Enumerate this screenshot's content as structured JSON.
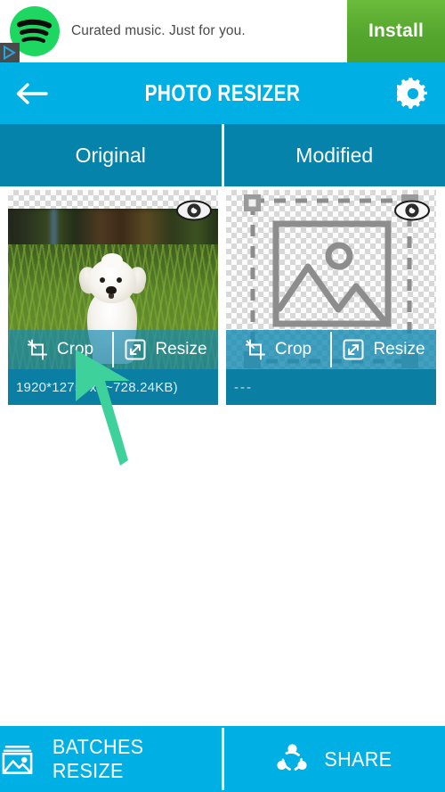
{
  "ad": {
    "advertiser_icon": "spotify-logo",
    "text": "Curated music. Just for you.",
    "install_label": "Install",
    "adchoices_icon": "adchoices-icon",
    "green_color": "#55a62e",
    "logo_color": "#1ed760"
  },
  "header": {
    "back_icon": "arrow-left-icon",
    "title": "PHOTO RESIZER",
    "settings_icon": "gear-icon",
    "background": "#00b0e4"
  },
  "tabs": [
    {
      "label": "Original",
      "selected": true
    },
    {
      "label": "Modified",
      "selected": false
    }
  ],
  "tab_background": "#0583ab",
  "cards": [
    {
      "name": "original",
      "preview_icon": "dog-photo",
      "eye_icon": "eye-icon",
      "crop_label": "Crop",
      "crop_icon": "crop-icon",
      "resize_label": "Resize",
      "resize_icon": "resize-icon",
      "info": "1920*1275px (~728.24KB)"
    },
    {
      "name": "modified",
      "preview_icon": "image-placeholder-icon",
      "eye_icon": "eye-icon",
      "crop_label": "Crop",
      "crop_icon": "crop-icon",
      "resize_label": "Resize",
      "resize_icon": "resize-icon",
      "info": "---"
    }
  ],
  "bottom_bar": {
    "batches_label": "BATCHES RESIZE",
    "batches_icon": "images-stack-icon",
    "share_label": "SHARE",
    "share_icon": "share-nodes-icon",
    "background": "#00b0e4"
  },
  "cursor": {
    "icon": "arrow-cursor",
    "color": "#3fd19b"
  }
}
